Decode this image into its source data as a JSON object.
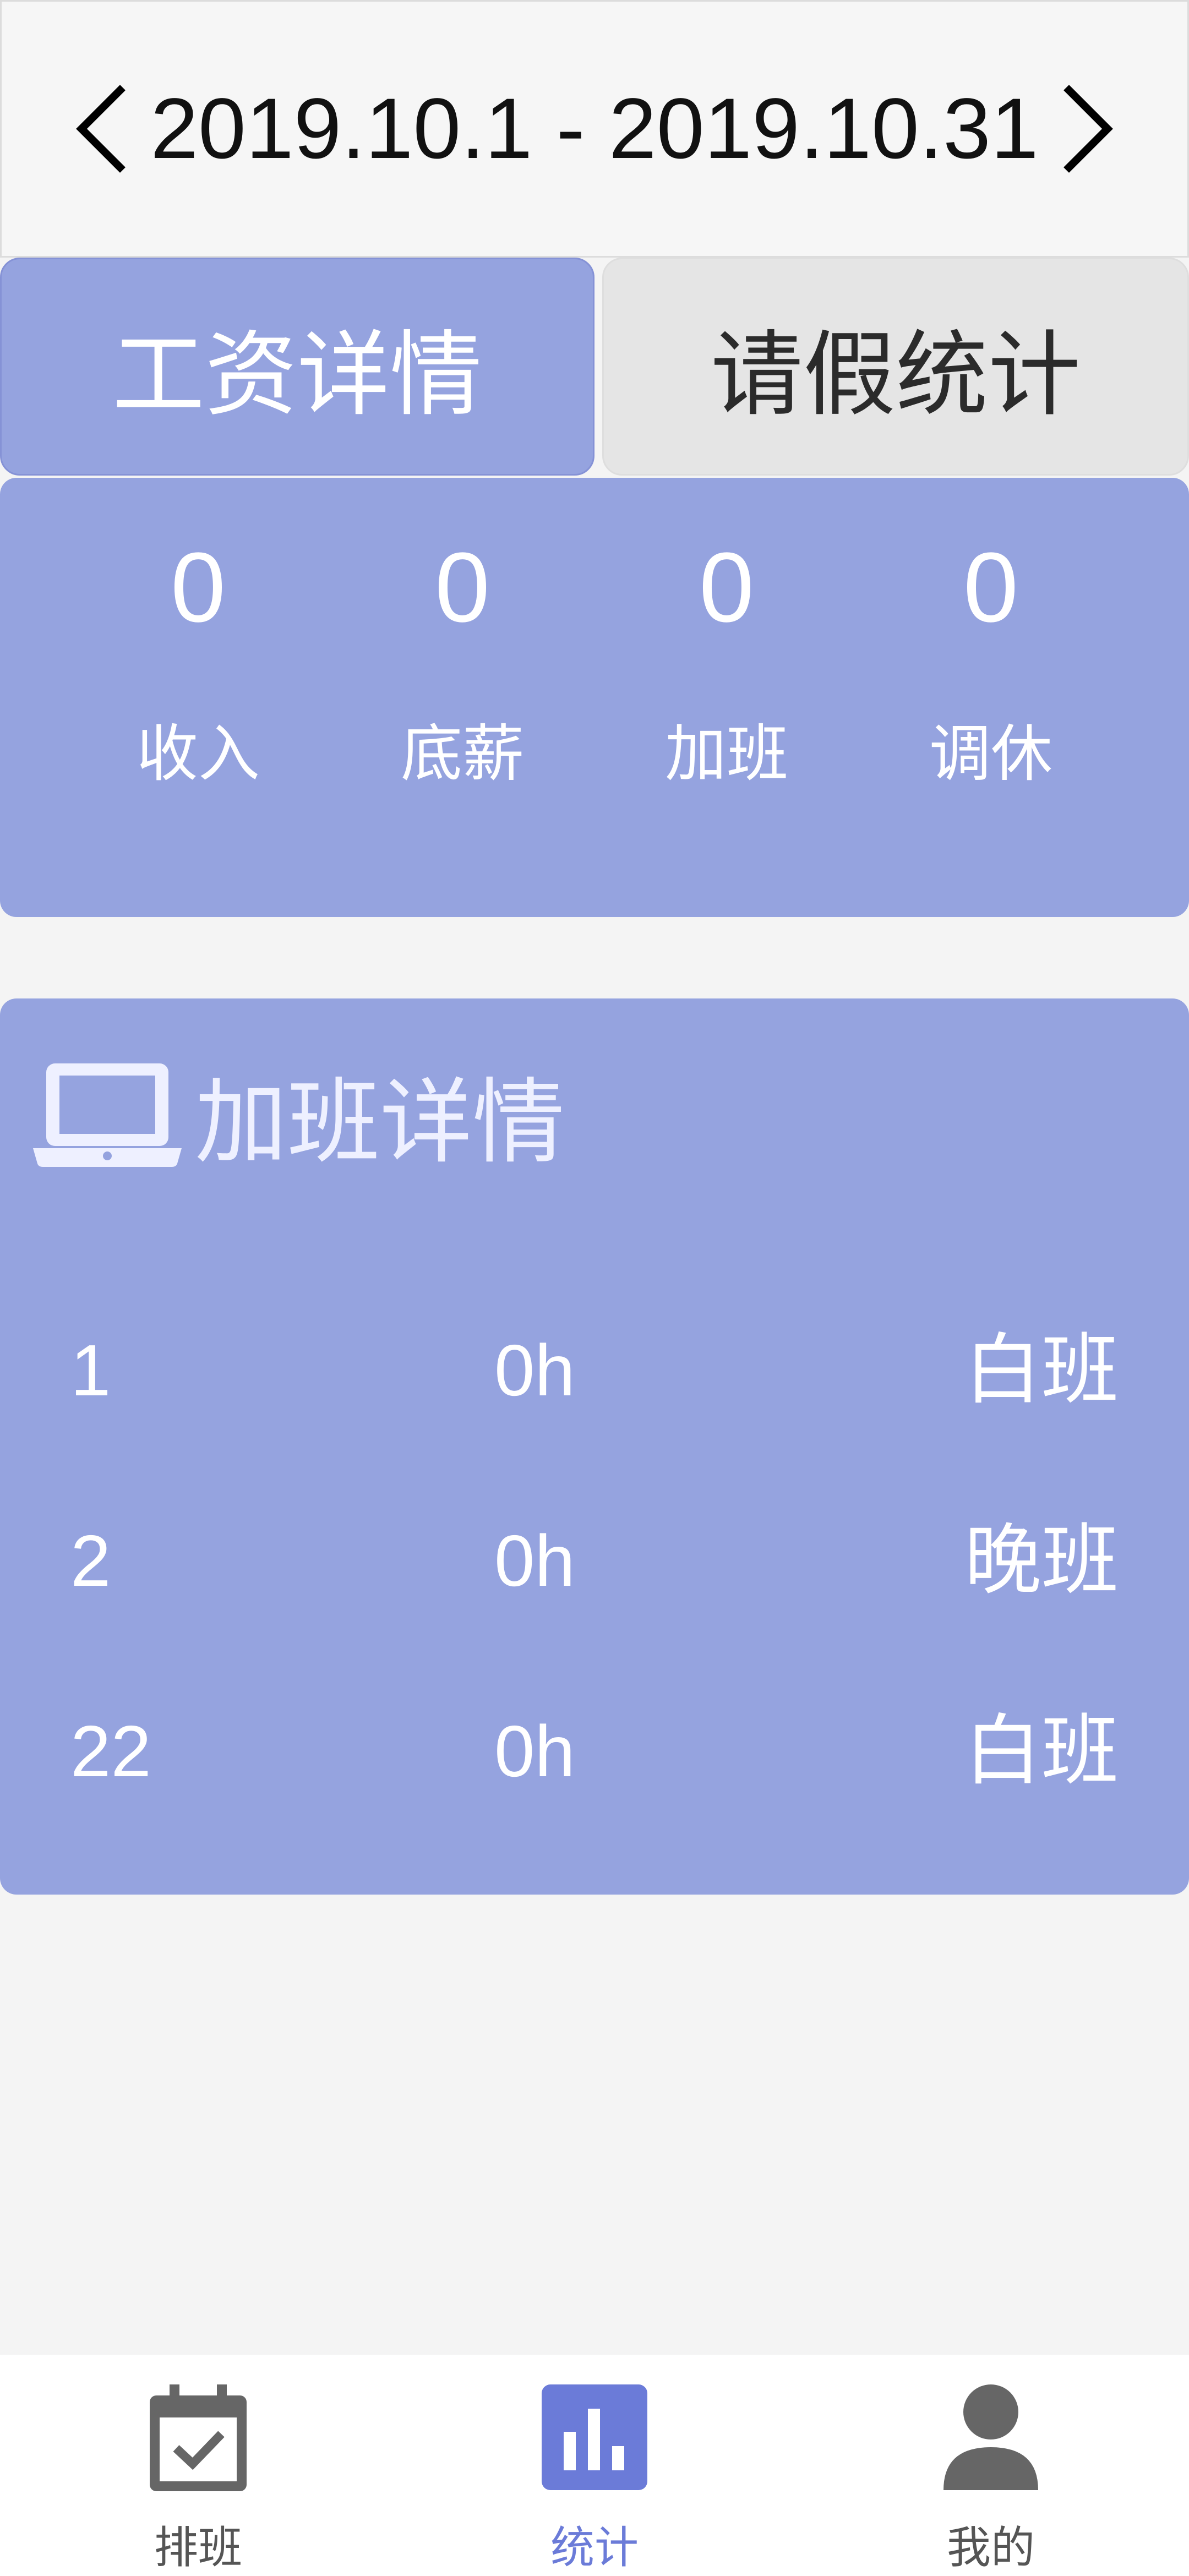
{
  "header": {
    "date_range": "2019.10.1 - 2019.10.31"
  },
  "tabs": {
    "salary": "工资详情",
    "leave": "请假统计",
    "active": "salary"
  },
  "summary": {
    "items": [
      {
        "value": "0",
        "label": "收入"
      },
      {
        "value": "0",
        "label": "底薪"
      },
      {
        "value": "0",
        "label": "加班"
      },
      {
        "value": "0",
        "label": "调休"
      }
    ]
  },
  "overtime": {
    "title": "加班详情",
    "icon": "laptop-icon",
    "rows": [
      {
        "day": "1",
        "hours": "0h",
        "shift": "白班"
      },
      {
        "day": "2",
        "hours": "0h",
        "shift": "晚班"
      },
      {
        "day": "22",
        "hours": "0h",
        "shift": "白班"
      }
    ]
  },
  "tabbar": {
    "items": [
      {
        "label": "排班",
        "icon": "calendar-check-icon",
        "active": false
      },
      {
        "label": "统计",
        "icon": "bar-chart-icon",
        "active": true
      },
      {
        "label": "我的",
        "icon": "user-icon",
        "active": false
      }
    ]
  },
  "colors": {
    "accent": "#95a3df",
    "active_tab": "#6b7bd8",
    "inactive_tab": "#e5e5e5"
  }
}
